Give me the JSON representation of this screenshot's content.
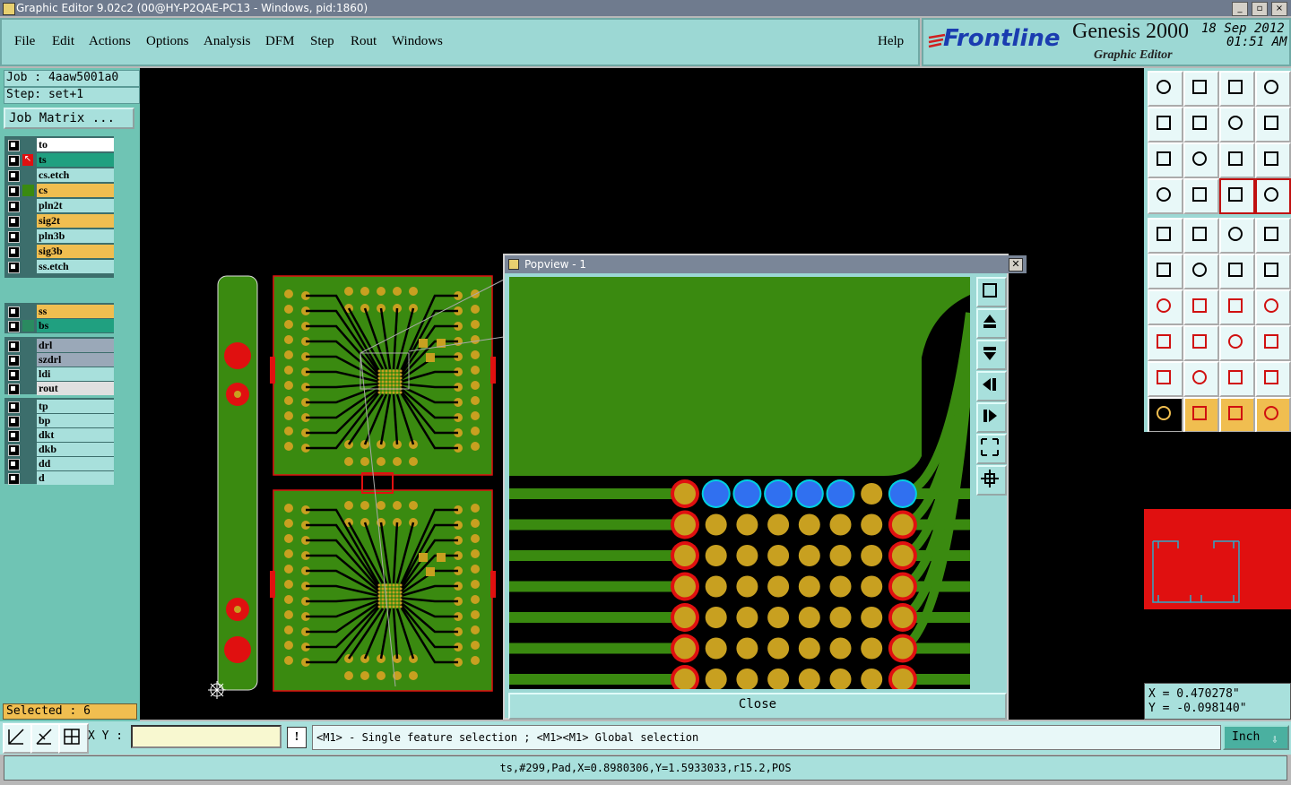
{
  "window": {
    "title": "Graphic Editor 9.02c2 (00@HY-P2QAE-PC13 - Windows, pid:1860)",
    "controls": [
      "_",
      "▫",
      "×"
    ]
  },
  "menu": {
    "items": [
      "File",
      "Edit",
      "Actions",
      "Options",
      "Analysis",
      "DFM",
      "Step",
      "Rout",
      "Windows"
    ],
    "help": "Help"
  },
  "brand": {
    "logo": "Frontline",
    "product": "Genesis 2000",
    "subtitle": "Graphic Editor",
    "date": "18 Sep 2012",
    "time": "01:51 AM"
  },
  "job": {
    "job_label": "Job : 4aaw5001a0",
    "step_label": "Step: set+1",
    "matrix_button": "Job Matrix ..."
  },
  "layers": {
    "group1": [
      {
        "name": "to",
        "color": "#ffffff"
      },
      {
        "name": "ts",
        "color": "#20a080"
      },
      {
        "name": "cs.etch",
        "color": "#a8e0dc"
      },
      {
        "name": "cs",
        "color": "#f0be50"
      },
      {
        "name": "pln2t",
        "color": "#a8e0dc"
      },
      {
        "name": "sig2t",
        "color": "#f0be50"
      },
      {
        "name": "pln3b",
        "color": "#a8e0dc"
      },
      {
        "name": "sig3b",
        "color": "#f0be50"
      },
      {
        "name": "ss.etch",
        "color": "#a8e0dc"
      }
    ],
    "group2": [
      {
        "name": "ss",
        "color": "#f0be50"
      },
      {
        "name": "bs",
        "color": "#20a080"
      }
    ],
    "group3": [
      {
        "name": "drl",
        "color": "#9aa8b8"
      },
      {
        "name": "szdrl",
        "color": "#9aa8b8"
      },
      {
        "name": "ldi",
        "color": "#a8e0dc"
      },
      {
        "name": "rout",
        "color": "#e0e0e0"
      }
    ],
    "group4": [
      {
        "name": "tp",
        "color": "#a8e0dc"
      },
      {
        "name": "bp",
        "color": "#a8e0dc"
      },
      {
        "name": "dkt",
        "color": "#a8e0dc"
      },
      {
        "name": "dkb",
        "color": "#a8e0dc"
      },
      {
        "name": "dd",
        "color": "#a8e0dc"
      },
      {
        "name": "d",
        "color": "#a8e0dc"
      }
    ]
  },
  "selection": {
    "label": "Selected : 6"
  },
  "popview": {
    "title": "Popview - 1",
    "close_label": "Close"
  },
  "coords": {
    "x": "X = 0.470278\"",
    "y": "Y = -0.098140\""
  },
  "bottom": {
    "xy_label": "X Y :",
    "xy_value": "",
    "warn": "!",
    "hint": "<M1> - Single feature selection ; <M1><M1> Global selection",
    "unit": "Inch"
  },
  "status": {
    "text": "ts,#299,Pad,X=0.8980306,Y=1.5933033,r15.2,POS"
  },
  "colors": {
    "board": "#3a8a10",
    "pad": "#c8a020",
    "pad_ring": "#e01010",
    "selected_pad": "#3070f0",
    "trace": "#000000"
  }
}
